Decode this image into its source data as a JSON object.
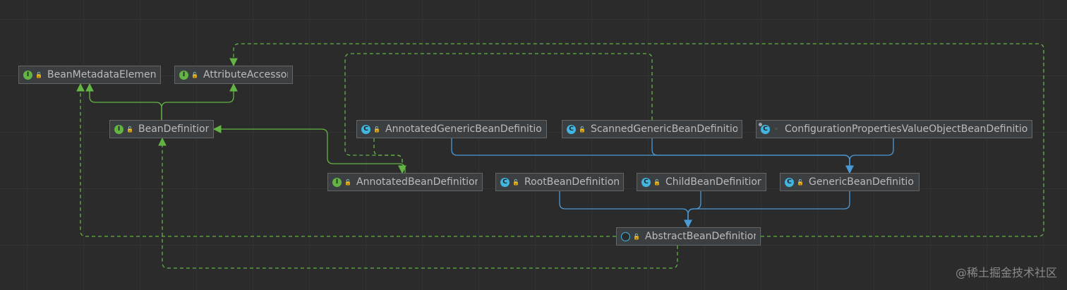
{
  "colors": {
    "inheritance_edge": "#62b543",
    "implementation_edge": "#62b543",
    "extends_edge": "#4a9ad8"
  },
  "nodes": [
    {
      "key": "bme",
      "label": "BeanMetadataElement",
      "kind": "interface",
      "visibility_icon": "public-icon"
    },
    {
      "key": "aa",
      "label": "AttributeAccessor",
      "kind": "interface",
      "visibility_icon": "public-icon"
    },
    {
      "key": "bd",
      "label": "BeanDefinition",
      "kind": "interface",
      "visibility_icon": "public-icon"
    },
    {
      "key": "agbd",
      "label": "AnnotatedGenericBeanDefinition",
      "kind": "class",
      "visibility_icon": "public-icon"
    },
    {
      "key": "sgbd",
      "label": "ScannedGenericBeanDefinition",
      "kind": "class",
      "visibility_icon": "public-icon"
    },
    {
      "key": "cpvobd",
      "label": "ConfigurationPropertiesValueObjectBeanDefinition",
      "kind": "annotated-class",
      "visibility_icon": "package-private-icon"
    },
    {
      "key": "abd",
      "label": "AnnotatedBeanDefinition",
      "kind": "interface",
      "visibility_icon": "public-icon"
    },
    {
      "key": "rbd",
      "label": "RootBeanDefinition",
      "kind": "class",
      "visibility_icon": "public-icon"
    },
    {
      "key": "cbd",
      "label": "ChildBeanDefinition",
      "kind": "class",
      "visibility_icon": "public-icon"
    },
    {
      "key": "gbd",
      "label": "GenericBeanDefinition",
      "kind": "class",
      "visibility_icon": "public-icon"
    },
    {
      "key": "absbd",
      "label": "AbstractBeanDefinition",
      "kind": "abstract-class",
      "visibility_icon": "public-icon"
    }
  ],
  "edges": [
    {
      "from": "bd",
      "to": "bme",
      "type": "interface-extends"
    },
    {
      "from": "bd",
      "to": "aa",
      "type": "interface-extends"
    },
    {
      "from": "abd",
      "to": "bd",
      "type": "interface-extends"
    },
    {
      "from": "agbd",
      "to": "abd",
      "type": "implements"
    },
    {
      "from": "sgbd",
      "to": "abd",
      "type": "implements"
    },
    {
      "from": "agbd",
      "to": "gbd",
      "type": "extends"
    },
    {
      "from": "sgbd",
      "to": "gbd",
      "type": "extends"
    },
    {
      "from": "cpvobd",
      "to": "gbd",
      "type": "extends"
    },
    {
      "from": "rbd",
      "to": "absbd",
      "type": "extends"
    },
    {
      "from": "cbd",
      "to": "absbd",
      "type": "extends"
    },
    {
      "from": "gbd",
      "to": "absbd",
      "type": "extends"
    },
    {
      "from": "absbd",
      "to": "bme",
      "type": "implements"
    },
    {
      "from": "absbd",
      "to": "aa",
      "type": "implements"
    },
    {
      "from": "absbd",
      "to": "bd",
      "type": "implements"
    }
  ],
  "watermark": "@稀土掘金技术社区"
}
